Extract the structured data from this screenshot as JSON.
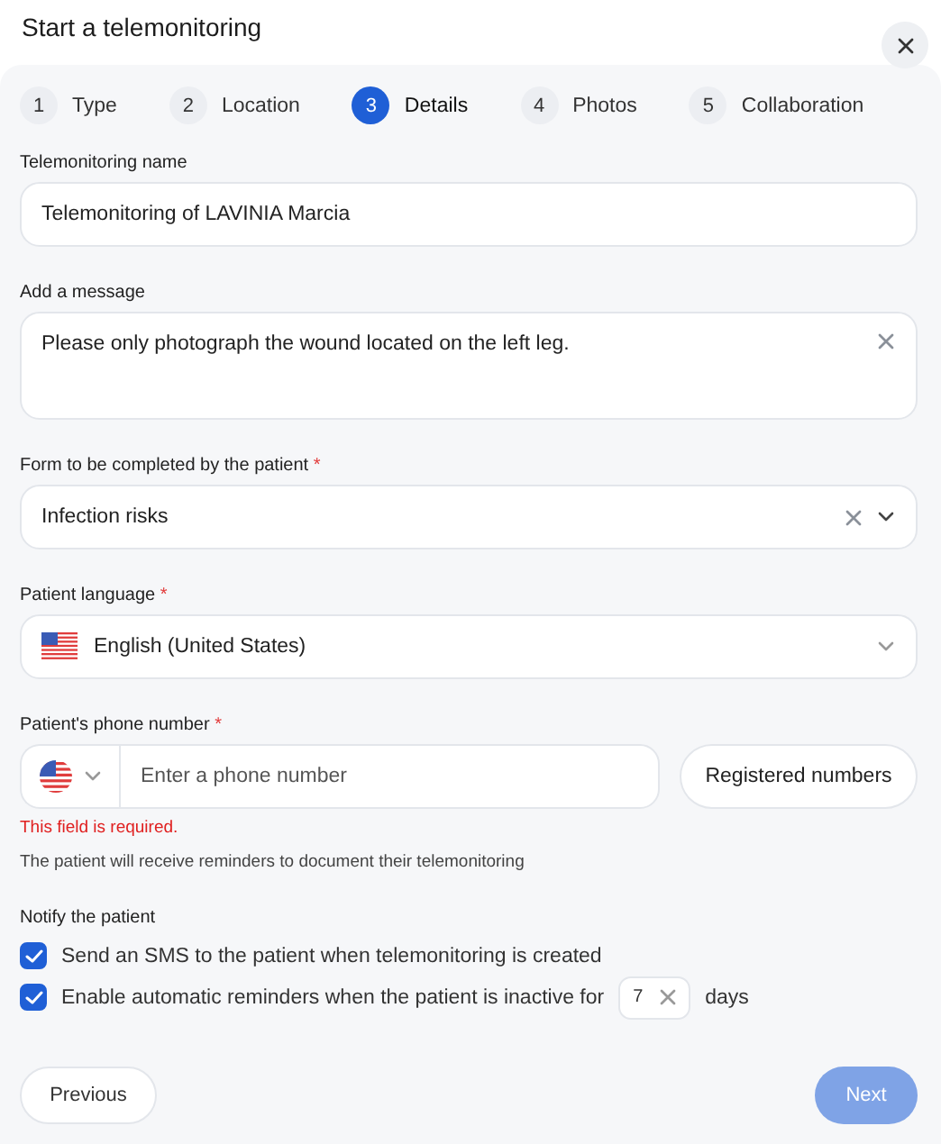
{
  "window": {
    "title": "Start a telemonitoring"
  },
  "steps": [
    {
      "number": "1",
      "label": "Type",
      "selected": false
    },
    {
      "number": "2",
      "label": "Location",
      "selected": false
    },
    {
      "number": "3",
      "label": "Details",
      "selected": true
    },
    {
      "number": "4",
      "label": "Photos",
      "selected": false
    },
    {
      "number": "5",
      "label": "Collaboration",
      "selected": false
    }
  ],
  "fields": [
    {
      "kind": "text",
      "label": "Telemonitoring name",
      "value": "Telemonitoring of LAVINIA Marcia"
    },
    {
      "kind": "textarea",
      "label": "Add a message",
      "value": "Please only photograph the wound located on the left leg.",
      "clearable": true
    },
    {
      "kind": "select",
      "label": "Form to be completed by the patient",
      "required_mark": "*",
      "value": "Infection risks",
      "clearable": true
    },
    {
      "kind": "language",
      "label": "Patient language",
      "required_mark": "*",
      "value": "English (United States)"
    },
    {
      "kind": "phone",
      "label": "Patient's phone number",
      "required_mark": "*",
      "placeholder": "Enter a phone number",
      "button": "Registered numbers",
      "error": "This field is required.",
      "hint": "The patient will receive reminders to document their telemonitoring"
    }
  ],
  "notify": {
    "label": "Notify the patient",
    "options": [
      {
        "kind": "plain",
        "label": "Send an SMS to the patient when telemonitoring is created",
        "checked": true
      },
      {
        "kind": "days",
        "label": "Enable automatic reminders when the patient is inactive for",
        "value": "7",
        "suffix": "days",
        "checked": true
      }
    ]
  },
  "buttons": {
    "previous": {
      "label": "Previous"
    },
    "next": {
      "label": "Next",
      "disabled": true
    }
  }
}
